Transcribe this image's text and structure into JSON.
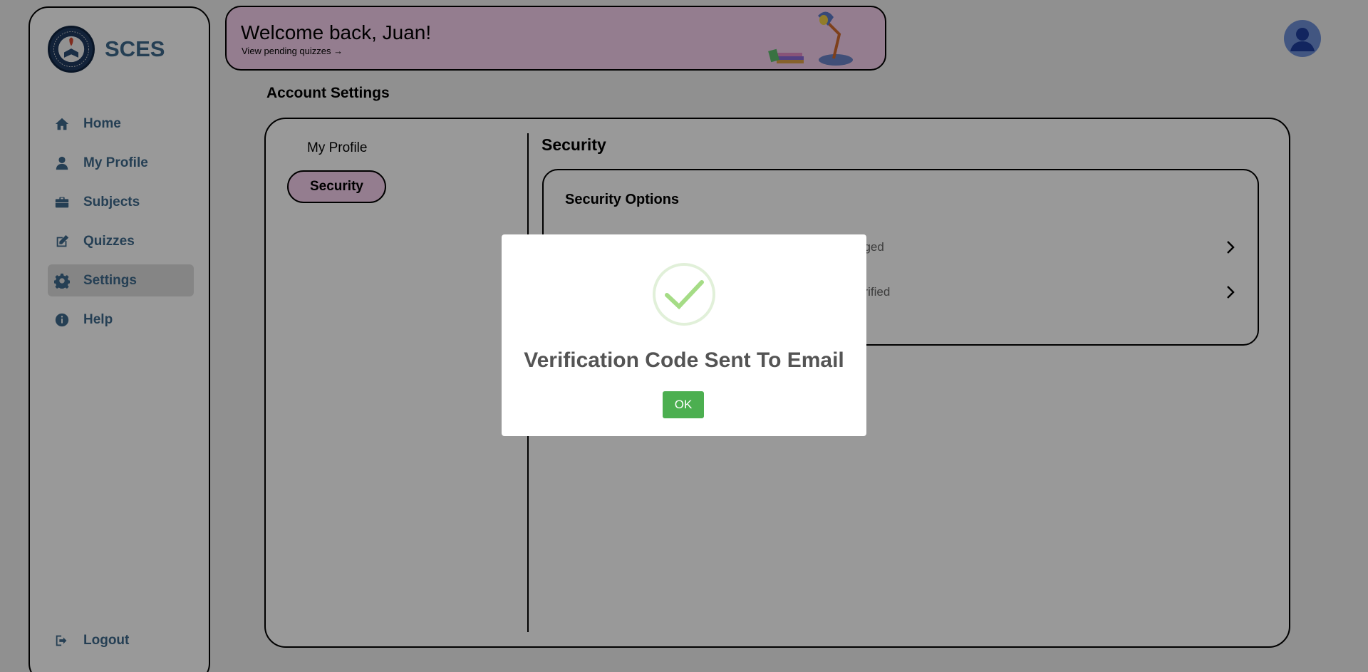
{
  "brand": {
    "name": "SCES",
    "logo_icon": "school-seal-logo"
  },
  "sidebar": {
    "items": [
      {
        "label": "Home",
        "icon": "home-icon"
      },
      {
        "label": "My Profile",
        "icon": "user-icon"
      },
      {
        "label": "Subjects",
        "icon": "briefcase-icon"
      },
      {
        "label": "Quizzes",
        "icon": "edit-icon"
      },
      {
        "label": "Settings",
        "icon": "gear-icon",
        "active": true
      },
      {
        "label": "Help",
        "icon": "info-icon"
      }
    ],
    "logout_label": "Logout"
  },
  "banner": {
    "title": "Welcome back, Juan!",
    "link": "View pending quizzes →"
  },
  "page": {
    "title": "Account Settings"
  },
  "settings_nav": {
    "profile_label": "My Profile",
    "security_label": "Security"
  },
  "security": {
    "title": "Security",
    "card_title": "Security Options",
    "rows": [
      {
        "text": "nged"
      },
      {
        "text": "erified"
      }
    ]
  },
  "modal": {
    "title": "Verification Code Sent To Email",
    "ok_label": "OK",
    "icon": "success-check-icon"
  },
  "colors": {
    "accent_pink": "#f7d1ef",
    "sidebar_text": "#3f6a8c",
    "ok_green": "#4caf50",
    "overlay": "rgba(0,0,0,0.4)"
  }
}
